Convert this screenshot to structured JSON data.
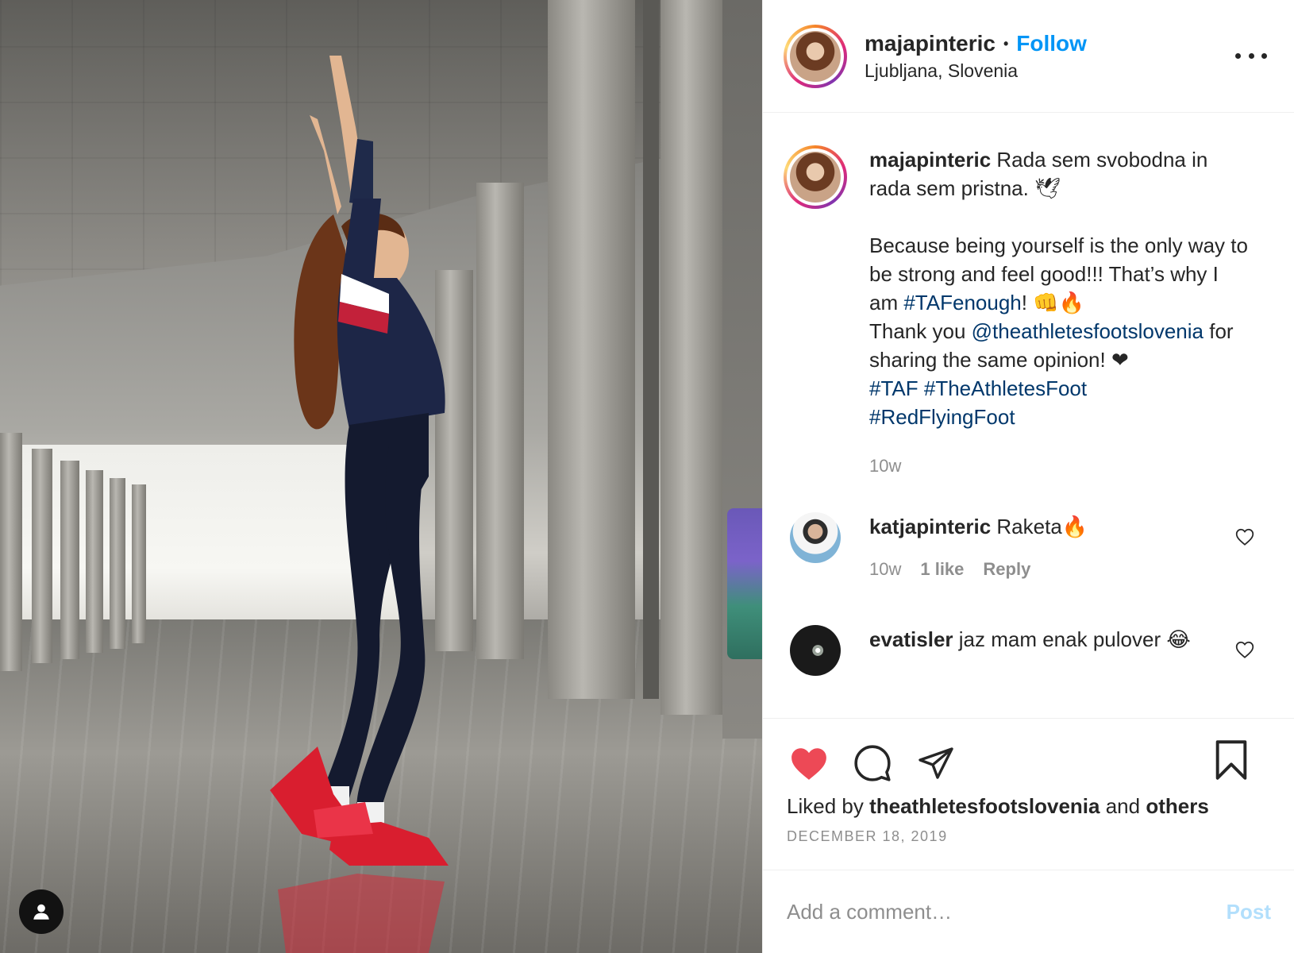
{
  "post": {
    "author": "majapinteric",
    "separator": "•",
    "follow_label": "Follow",
    "location": "Ljubljana, Slovenia"
  },
  "caption": {
    "username": "majapinteric",
    "line1": "Rada sem svobodna in rada sem pristna. 🕊",
    "para2_a": "Because being yourself is the only way to be strong and feel good!!! That’s why I am ",
    "hashtag_taf_enough": "#TAFenough",
    "para2_b": "! 👊🔥",
    "thank_you": "Thank you ",
    "mention": "@theathletesfootslovenia",
    "para2_c": " for sharing the same opinion! ❤",
    "hashtag_taf": "#TAF",
    "hashtag_athletes": "#TheAthletesFoot",
    "hashtag_red": "#RedFlyingFoot",
    "age": "10w"
  },
  "comments": [
    {
      "username": "katjapinteric",
      "text": "Raketa🔥",
      "age": "10w",
      "likes": "1 like",
      "reply": "Reply"
    },
    {
      "username": "evatisler",
      "text": "jaz mam enak pulover 😂"
    }
  ],
  "actions": {
    "liked": true,
    "liked_by_prefix": "Liked by ",
    "liked_by_user": "theathletesfootslovenia",
    "liked_by_and": " and ",
    "liked_by_others": "others",
    "date": "DECEMBER 18, 2019"
  },
  "add_comment": {
    "placeholder": "Add a comment…",
    "post_label": "Post"
  },
  "colors": {
    "follow": "#0095f6",
    "link": "#00376b",
    "heart": "#ed4956",
    "post_disabled": "#b2dffc"
  },
  "icons": [
    "more-options-icon",
    "heart-icon",
    "comment-icon",
    "share-icon",
    "bookmark-icon",
    "account-icon"
  ]
}
